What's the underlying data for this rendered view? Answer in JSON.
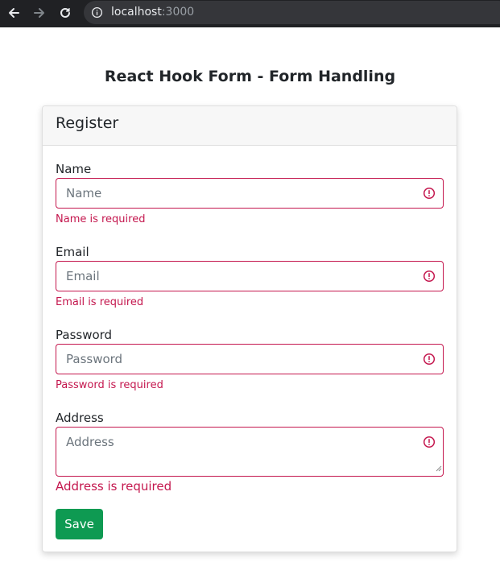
{
  "browser": {
    "url_host": "localhost",
    "url_port": ":3000",
    "icons": [
      "back-arrow-icon",
      "forward-arrow-icon",
      "reload-icon",
      "info-icon"
    ]
  },
  "page": {
    "title": "React Hook Form - Form Handling"
  },
  "form": {
    "header": "Register",
    "fields": {
      "name": {
        "label": "Name",
        "placeholder": "Name",
        "error": "Name is required"
      },
      "email": {
        "label": "Email",
        "placeholder": "Email",
        "error": "Email is required"
      },
      "password": {
        "label": "Password",
        "placeholder": "Password",
        "error": "Password is required"
      },
      "address": {
        "label": "Address",
        "placeholder": "Address",
        "error": "Address is required"
      }
    },
    "save_label": "Save"
  },
  "colors": {
    "error": "#c4174e",
    "save_button": "#0e9a52",
    "chrome_bg": "#202124"
  }
}
